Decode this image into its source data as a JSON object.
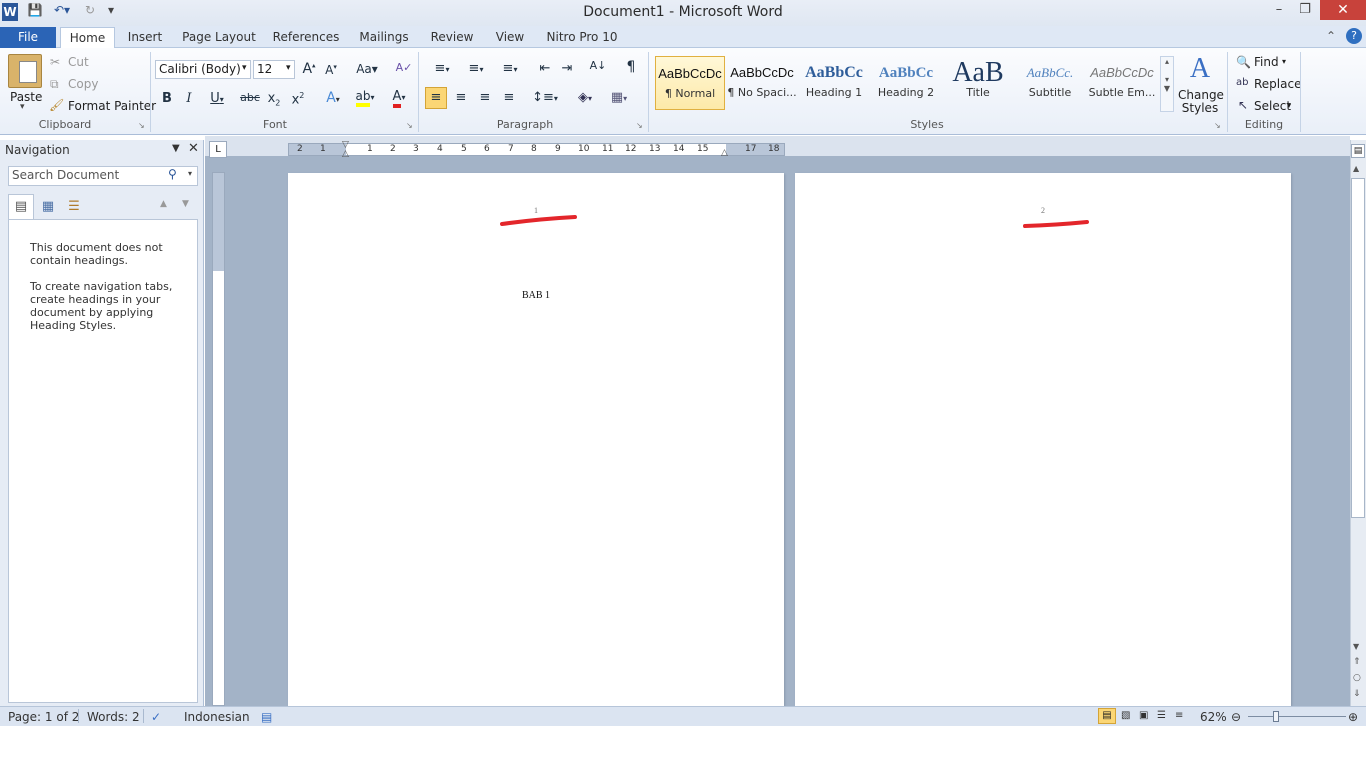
{
  "window": {
    "title": "Document1 - Microsoft Word"
  },
  "tabs": [
    "File",
    "Home",
    "Insert",
    "Page Layout",
    "References",
    "Mailings",
    "Review",
    "View",
    "Nitro Pro 10"
  ],
  "clipboard": {
    "paste": "Paste",
    "cut": "Cut",
    "copy": "Copy",
    "format_painter": "Format Painter",
    "label": "Clipboard"
  },
  "font": {
    "name": "Calibri (Body)",
    "size": "12",
    "label": "Font",
    "change_case": "Aa"
  },
  "paragraph": {
    "label": "Paragraph"
  },
  "styles": {
    "label": "Styles",
    "items": [
      {
        "sample": "AaBbCcDc",
        "name": "¶ Normal"
      },
      {
        "sample": "AaBbCcDc",
        "name": "¶ No Spaci..."
      },
      {
        "sample": "AaBbCc",
        "name": "Heading 1"
      },
      {
        "sample": "AaBbCc",
        "name": "Heading 2"
      },
      {
        "sample": "AaB",
        "name": "Title"
      },
      {
        "sample": "AaBbCc.",
        "name": "Subtitle"
      },
      {
        "sample": "AaBbCcDc",
        "name": "Subtle Em..."
      }
    ],
    "change_styles": "Change Styles"
  },
  "editing": {
    "find": "Find",
    "replace": "Replace",
    "select": "Select",
    "label": "Editing"
  },
  "navigation": {
    "title": "Navigation",
    "search_placeholder": "Search Document",
    "message1": "This document does not contain headings.",
    "message2": "To create navigation tabs, create headings in your document by applying Heading Styles."
  },
  "ruler": {
    "labels": [
      "2",
      "1",
      "1",
      "2",
      "3",
      "4",
      "5",
      "6",
      "7",
      "8",
      "9",
      "10",
      "11",
      "12",
      "13",
      "14",
      "15",
      "17",
      "18"
    ]
  },
  "pages": [
    {
      "number": "1",
      "body": "BAB 1"
    },
    {
      "number": "2",
      "body": ""
    }
  ],
  "status": {
    "page": "Page: 1 of 2",
    "words": "Words: 2",
    "language": "Indonesian",
    "zoom": "62%"
  }
}
